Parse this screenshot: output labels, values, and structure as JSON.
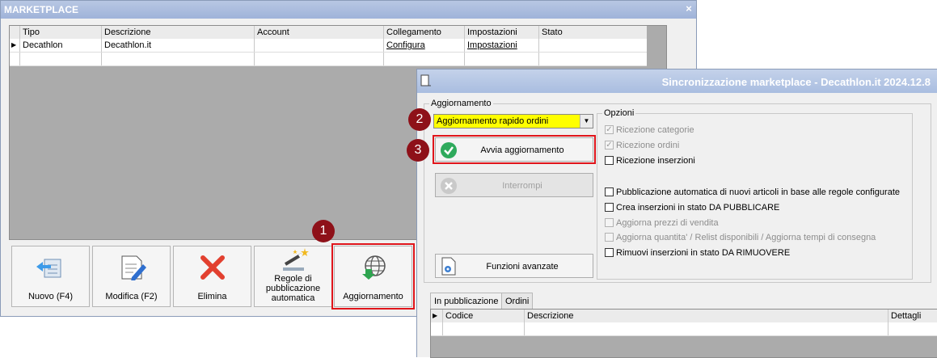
{
  "marketplace": {
    "title": "MARKETPLACE",
    "close_glyph": "×",
    "columns": [
      "Tipo",
      "Descrizione",
      "Account",
      "Collegamento",
      "Impostazioni",
      "Stato"
    ],
    "rows": [
      {
        "tipo": "Decathlon",
        "descrizione": "Decathlon.it",
        "account": "",
        "collegamento": "Configura",
        "impostazioni": "Impostazioni",
        "stato": ""
      }
    ],
    "buttons": {
      "nuovo": "Nuovo (F4)",
      "modifica": "Modifica (F2)",
      "elimina": "Elimina",
      "regole": "Regole di pubblicazione automatica",
      "aggiornamento": "Aggiornamento"
    }
  },
  "badges": {
    "one": "1",
    "two": "2",
    "three": "3"
  },
  "sync": {
    "title": "Sincronizzazione marketplace - Decathlon.it 2024.12.8",
    "aggiornamento_legend": "Aggiornamento",
    "select_value": "Aggiornamento rapido ordini",
    "avvia_label": "Avvia aggiornamento",
    "interrompi_label": "Interrompi",
    "funzioni_label": "Funzioni avanzate",
    "opzioni_legend": "Opzioni",
    "options": [
      {
        "label": "Ricezione categorie",
        "checked": true,
        "enabled": false
      },
      {
        "label": "Ricezione ordini",
        "checked": true,
        "enabled": false
      },
      {
        "label": "Ricezione inserzioni",
        "checked": false,
        "enabled": true
      },
      {
        "label": "Pubblicazione automatica di nuovi articoli in base alle regole configurate",
        "checked": false,
        "enabled": true
      },
      {
        "label": "Crea inserzioni in stato DA PUBBLICARE",
        "checked": false,
        "enabled": true
      },
      {
        "label": "Aggiorna prezzi di vendita",
        "checked": false,
        "enabled": false
      },
      {
        "label": "Aggiorna quantita' / Relist disponibili / Aggiorna tempi di consegna",
        "checked": false,
        "enabled": false
      },
      {
        "label": "Rimuovi inserzioni in stato DA RIMUOVERE",
        "checked": false,
        "enabled": true
      }
    ],
    "tabs": [
      "In pubblicazione",
      "Ordini"
    ],
    "columns": [
      "Codice",
      "Descrizione",
      "Dettagli"
    ]
  },
  "colors": {
    "highlight": "#e0151b",
    "badge": "#8e1119",
    "select_bg": "#ffff00",
    "check_green": "#2eaa5c"
  }
}
